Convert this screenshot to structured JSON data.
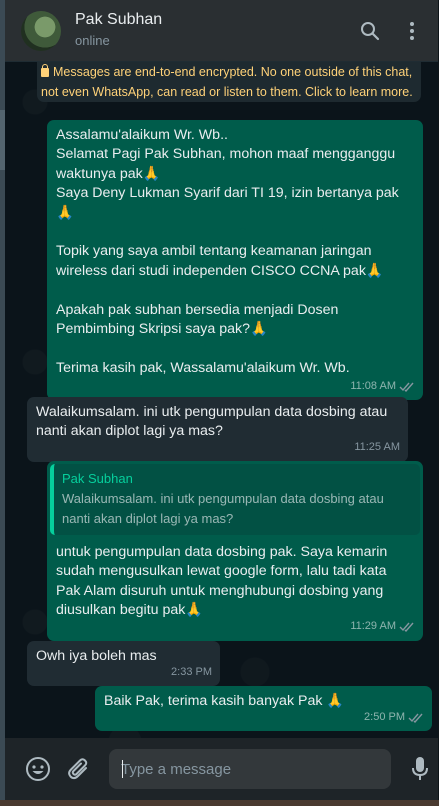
{
  "header": {
    "contact_name": "Pak Subhan",
    "contact_status": "online",
    "icons": [
      "search-icon",
      "menu-icon"
    ]
  },
  "encryption_notice": "Messages are end-to-end encrypted. No one outside of this chat, not even WhatsApp, can read or listen to them. Click to learn more.",
  "messages": [
    {
      "direction": "out",
      "lines": [
        "Assalamu'alaikum Wr. Wb..",
        "Selamat Pagi Pak Subhan, mohon maaf mengganggu waktunya pak🙏",
        "Saya Deny Lukman Syarif dari TI 19, izin bertanya pak🙏",
        "",
        "Topik yang saya ambil tentang keamanan jaringan wireless dari studi independen CISCO CCNA pak🙏",
        "",
        "Apakah pak subhan bersedia menjadi Dosen Pembimbing Skripsi saya pak?🙏",
        "",
        "Terima kasih pak, Wassalamu'alaikum Wr. Wb."
      ],
      "time": "11:08 AM",
      "status": "read"
    },
    {
      "direction": "in",
      "text": "Walaikumsalam. ini utk pengumpulan data dosbing atau nanti akan diplot lagi ya mas?",
      "time": "11:25 AM"
    },
    {
      "direction": "out",
      "quote": {
        "author": "Pak Subhan",
        "text": "Walaikumsalam. ini utk pengumpulan data dosbing atau nanti akan diplot lagi ya mas?"
      },
      "text": "untuk pengumpulan data dosbing pak. Saya kemarin sudah mengusulkan lewat google form, lalu tadi kata Pak Alam disuruh untuk menghubungi dosbing yang diusulkan begitu pak🙏",
      "time": "11:29 AM",
      "status": "read"
    },
    {
      "direction": "in",
      "text": "Owh iya boleh mas",
      "time": "2:33 PM"
    },
    {
      "direction": "out",
      "text": "Baik Pak, terima kasih banyak Pak 🙏",
      "time": "2:50 PM",
      "status": "read"
    }
  ],
  "composer": {
    "placeholder": "Type a message",
    "icons": [
      "emoji-icon",
      "attach-icon",
      "microphone-icon"
    ]
  },
  "colors": {
    "header_bg": "#2a2f32",
    "chat_bg": "#0b141a",
    "outgoing_bubble": "#005c4b",
    "incoming_bubble": "#202c33",
    "encryption_text": "#ffd279",
    "accent": "#06cf9c"
  }
}
